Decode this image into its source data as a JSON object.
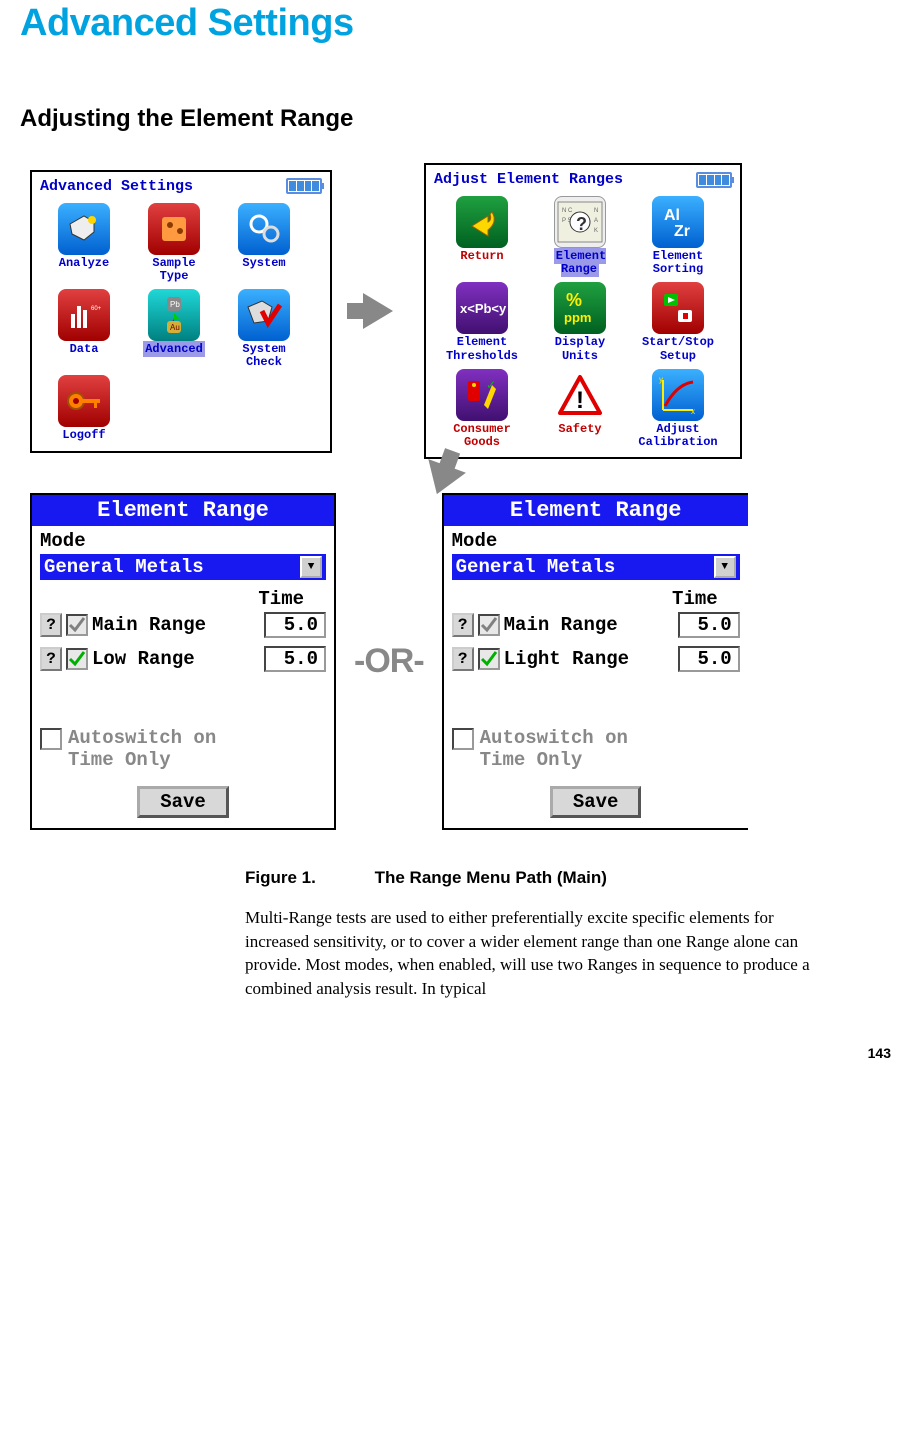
{
  "page_title": "Advanced Settings",
  "section_title": "Adjusting the Element Range",
  "panel_advanced": {
    "title": "Advanced Settings",
    "items": [
      {
        "label": "Analyze"
      },
      {
        "label": "Sample\nType"
      },
      {
        "label": "System"
      },
      {
        "label": "Data"
      },
      {
        "label": "Advanced",
        "highlight": true
      },
      {
        "label": "System\nCheck"
      },
      {
        "label": "Logoff"
      }
    ]
  },
  "panel_adjust": {
    "title": "Adjust Element Ranges",
    "items": [
      {
        "label": "Return",
        "red": true
      },
      {
        "label": "Element\nRange",
        "highlight": true
      },
      {
        "label": "Element\nSorting"
      },
      {
        "label": "Element\nThresholds"
      },
      {
        "label": "Display\nUnits"
      },
      {
        "label": "Start/Stop\nSetup"
      },
      {
        "label": "Consumer\nGoods",
        "red": true
      },
      {
        "label": "Safety",
        "red": true
      },
      {
        "label": "Adjust\nCalibration"
      }
    ]
  },
  "or_text": "-OR-",
  "er_left": {
    "title": "Element Range",
    "mode_label": "Mode",
    "mode_value": "General Metals",
    "time_label": "Time",
    "rows": [
      {
        "name": "Main Range",
        "value": "5.0",
        "check_color": "#808080"
      },
      {
        "name": "Low Range",
        "value": "5.0",
        "check_color": "#00B000"
      }
    ],
    "autoswitch": "Autoswitch on\nTime Only",
    "save": "Save"
  },
  "er_right": {
    "title": "Element Range",
    "mode_label": "Mode",
    "mode_value": "General Metals",
    "time_label": "Time",
    "rows": [
      {
        "name": "Main Range",
        "value": "5.0",
        "check_color": "#808080"
      },
      {
        "name": "Light Range",
        "value": "5.0",
        "check_color": "#00B000"
      }
    ],
    "autoswitch": "Autoswitch on\nTime Only",
    "save": "Save"
  },
  "caption": {
    "fig_num": "Figure 1.",
    "fig_title": "The Range Menu Path (Main)",
    "body": "Multi-Range tests are used to either preferentially excite specific elements for increased sensitivity, or to cover a wider element range than one Range alone can provide. Most modes, when enabled, will use two Ranges in sequence to produce a combined analysis result. In typical"
  },
  "page_number": "143"
}
